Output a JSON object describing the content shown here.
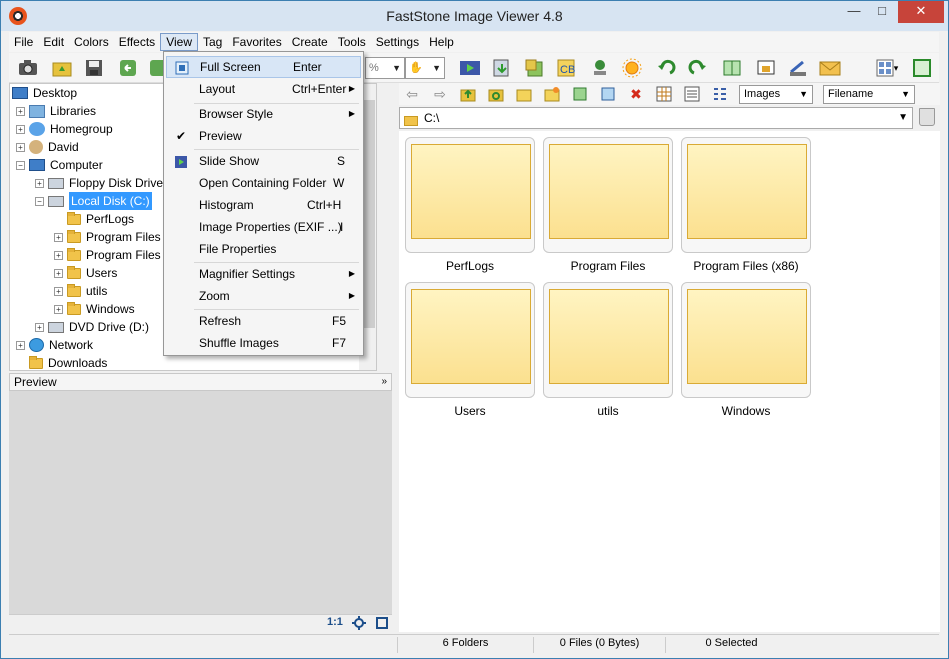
{
  "window": {
    "title": "FastStone Image Viewer 4.8",
    "min_glyph": "—",
    "max_glyph": "□",
    "close_glyph": "✕"
  },
  "menubar": [
    "File",
    "Edit",
    "Colors",
    "Effects",
    "View",
    "Tag",
    "Favorites",
    "Create",
    "Tools",
    "Settings",
    "Help"
  ],
  "toolbar": {
    "zoom_value": "%",
    "zoom_arrow": "▼",
    "hand_arrow": "▼",
    "layout_arrow": "▾"
  },
  "tree": {
    "items": [
      {
        "label": "Desktop"
      },
      {
        "label": "Libraries"
      },
      {
        "label": "Homegroup"
      },
      {
        "label": "David"
      },
      {
        "label": "Computer"
      },
      {
        "label": "Floppy Disk Drive"
      },
      {
        "label": "Local Disk (C:)"
      },
      {
        "label": "PerfLogs"
      },
      {
        "label": "Program Files"
      },
      {
        "label": "Program Files"
      },
      {
        "label": "Users"
      },
      {
        "label": "utils"
      },
      {
        "label": "Windows"
      },
      {
        "label": "DVD Drive (D:)"
      },
      {
        "label": "Network"
      },
      {
        "label": "Downloads"
      }
    ],
    "plus": "+",
    "minus": "−"
  },
  "preview": {
    "title": "Preview",
    "chevron": "»",
    "ratio_label": "1:1"
  },
  "browser": {
    "filter_select": "Images",
    "sort_select": "Filename",
    "select_arrow": "▼",
    "address": "C:\\",
    "address_arrow": "▼"
  },
  "thumbnails": [
    {
      "label": "PerfLogs"
    },
    {
      "label": "Program Files"
    },
    {
      "label": "Program Files (x86)"
    },
    {
      "label": "Users"
    },
    {
      "label": "utils"
    },
    {
      "label": "Windows"
    }
  ],
  "status": {
    "folders": "6 Folders",
    "files": "0 Files (0 Bytes)",
    "selected": "0 Selected"
  },
  "view_menu": {
    "items": [
      {
        "label": "Full Screen",
        "shortcut": "Enter",
        "icon": "full-screen-icon",
        "highlighted": true
      },
      {
        "label": "Layout",
        "shortcut": "Ctrl+Enter",
        "submenu": true
      },
      {
        "label": "Browser Style",
        "submenu": true
      },
      {
        "label": "Preview",
        "checked": true
      },
      {
        "label": "Slide Show",
        "shortcut": "S",
        "icon": "slideshow-icon"
      },
      {
        "label": "Open Containing Folder",
        "shortcut": "W"
      },
      {
        "label": "Histogram",
        "shortcut": "Ctrl+H"
      },
      {
        "label": "Image Properties (EXIF ...)",
        "shortcut": "I"
      },
      {
        "label": "File Properties"
      },
      {
        "label": "Magnifier Settings",
        "submenu": true
      },
      {
        "label": "Zoom",
        "submenu": true
      },
      {
        "label": "Refresh",
        "shortcut": "F5"
      },
      {
        "label": "Shuffle Images",
        "shortcut": "F7"
      }
    ],
    "submenu_arrow": "▶",
    "check_glyph": "✔"
  },
  "colors": {
    "accent": "#3399ff",
    "highlight": "#d8e6f6",
    "folder": "#fbe08f",
    "close": "#c7443a"
  }
}
